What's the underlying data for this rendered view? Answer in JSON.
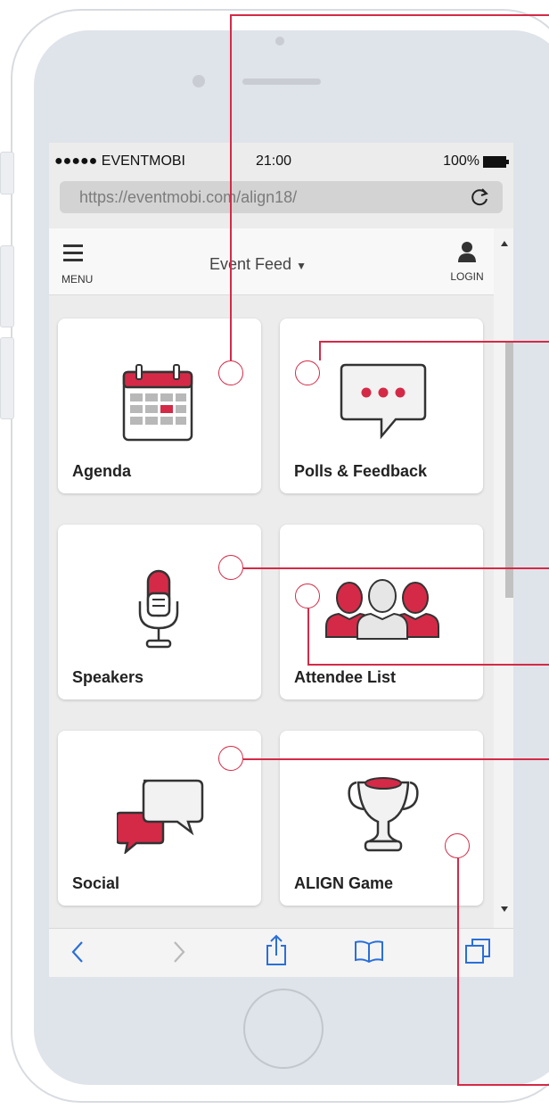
{
  "status_bar": {
    "carrier": "●●●●● EVENTMOBI",
    "time": "21:00",
    "battery": "100%"
  },
  "address_bar": {
    "url": "https://eventmobi.com/align18/"
  },
  "app_nav": {
    "menu_label": "MENU",
    "title": "Event Feed",
    "login_label": "LOGIN"
  },
  "tiles": [
    {
      "label": "Agenda",
      "icon": "calendar-icon"
    },
    {
      "label": "Polls & Feedback",
      "icon": "chat-bubble-icon"
    },
    {
      "label": "Speakers",
      "icon": "microphone-icon"
    },
    {
      "label": "Attendee List",
      "icon": "people-icon"
    },
    {
      "label": "Social",
      "icon": "speech-bubbles-icon"
    },
    {
      "label": "ALIGN Game",
      "icon": "trophy-icon"
    }
  ],
  "colors": {
    "accent": "#d42a47",
    "icon_stroke": "#333333",
    "page_bg": "#ececec"
  }
}
